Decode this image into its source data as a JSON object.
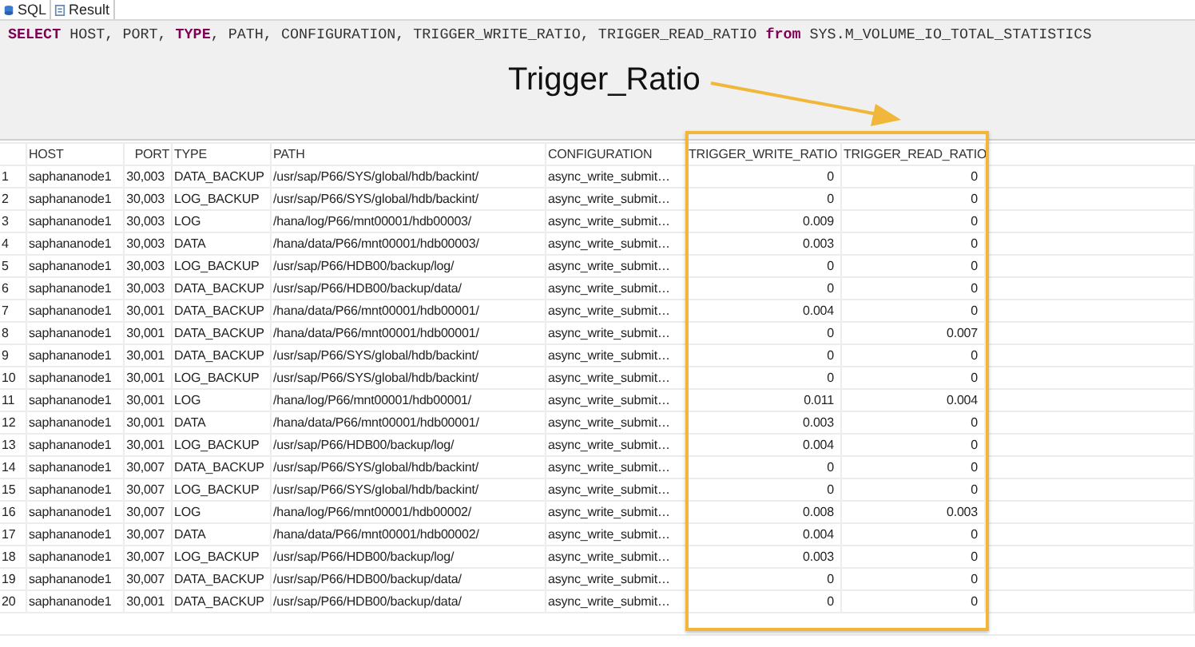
{
  "tabs": [
    {
      "label": "SQL"
    },
    {
      "label": "Result"
    }
  ],
  "sql": {
    "tokens": [
      {
        "text": "SELECT",
        "kind": "keyword"
      },
      {
        "text": " HOST, PORT, ",
        "kind": "plain"
      },
      {
        "text": "TYPE",
        "kind": "keyword"
      },
      {
        "text": ", PATH, CONFIGURATION, TRIGGER_WRITE_RATIO, TRIGGER_READ_RATIO ",
        "kind": "plain"
      },
      {
        "text": "from",
        "kind": "keyword"
      },
      {
        "text": " SYS.M_VOLUME_IO_TOTAL_STATISTICS",
        "kind": "plain"
      }
    ]
  },
  "annotation": {
    "label": "Trigger_Ratio"
  },
  "table": {
    "columns": [
      "",
      "HOST",
      "PORT",
      "TYPE",
      "PATH",
      "CONFIGURATION",
      "TRIGGER_WRITE_RATIO",
      "TRIGGER_READ_RATIO"
    ],
    "rows": [
      [
        "1",
        "saphananode1",
        "30,003",
        "DATA_BACKUP",
        "/usr/sap/P66/SYS/global/hdb/backint/",
        "async_write_submit…",
        "0",
        "0"
      ],
      [
        "2",
        "saphananode1",
        "30,003",
        "LOG_BACKUP",
        "/usr/sap/P66/SYS/global/hdb/backint/",
        "async_write_submit…",
        "0",
        "0"
      ],
      [
        "3",
        "saphananode1",
        "30,003",
        "LOG",
        "/hana/log/P66/mnt00001/hdb00003/",
        "async_write_submit…",
        "0.009",
        "0"
      ],
      [
        "4",
        "saphananode1",
        "30,003",
        "DATA",
        "/hana/data/P66/mnt00001/hdb00003/",
        "async_write_submit…",
        "0.003",
        "0"
      ],
      [
        "5",
        "saphananode1",
        "30,003",
        "LOG_BACKUP",
        "/usr/sap/P66/HDB00/backup/log/",
        "async_write_submit…",
        "0",
        "0"
      ],
      [
        "6",
        "saphananode1",
        "30,003",
        "DATA_BACKUP",
        "/usr/sap/P66/HDB00/backup/data/",
        "async_write_submit…",
        "0",
        "0"
      ],
      [
        "7",
        "saphananode1",
        "30,001",
        "DATA_BACKUP",
        "/hana/data/P66/mnt00001/hdb00001/",
        "async_write_submit…",
        "0.004",
        "0"
      ],
      [
        "8",
        "saphananode1",
        "30,001",
        "DATA_BACKUP",
        "/hana/data/P66/mnt00001/hdb00001/",
        "async_write_submit…",
        "0",
        "0.007"
      ],
      [
        "9",
        "saphananode1",
        "30,001",
        "DATA_BACKUP",
        "/usr/sap/P66/SYS/global/hdb/backint/",
        "async_write_submit…",
        "0",
        "0"
      ],
      [
        "10",
        "saphananode1",
        "30,001",
        "LOG_BACKUP",
        "/usr/sap/P66/SYS/global/hdb/backint/",
        "async_write_submit…",
        "0",
        "0"
      ],
      [
        "11",
        "saphananode1",
        "30,001",
        "LOG",
        "/hana/log/P66/mnt00001/hdb00001/",
        "async_write_submit…",
        "0.011",
        "0.004"
      ],
      [
        "12",
        "saphananode1",
        "30,001",
        "DATA",
        "/hana/data/P66/mnt00001/hdb00001/",
        "async_write_submit…",
        "0.003",
        "0"
      ],
      [
        "13",
        "saphananode1",
        "30,001",
        "LOG_BACKUP",
        "/usr/sap/P66/HDB00/backup/log/",
        "async_write_submit…",
        "0.004",
        "0"
      ],
      [
        "14",
        "saphananode1",
        "30,007",
        "DATA_BACKUP",
        "/usr/sap/P66/SYS/global/hdb/backint/",
        "async_write_submit…",
        "0",
        "0"
      ],
      [
        "15",
        "saphananode1",
        "30,007",
        "LOG_BACKUP",
        "/usr/sap/P66/SYS/global/hdb/backint/",
        "async_write_submit…",
        "0",
        "0"
      ],
      [
        "16",
        "saphananode1",
        "30,007",
        "LOG",
        "/hana/log/P66/mnt00001/hdb00002/",
        "async_write_submit…",
        "0.008",
        "0.003"
      ],
      [
        "17",
        "saphananode1",
        "30,007",
        "DATA",
        "/hana/data/P66/mnt00001/hdb00002/",
        "async_write_submit…",
        "0.004",
        "0"
      ],
      [
        "18",
        "saphananode1",
        "30,007",
        "LOG_BACKUP",
        "/usr/sap/P66/HDB00/backup/log/",
        "async_write_submit…",
        "0.003",
        "0"
      ],
      [
        "19",
        "saphananode1",
        "30,007",
        "DATA_BACKUP",
        "/usr/sap/P66/HDB00/backup/data/",
        "async_write_submit…",
        "0",
        "0"
      ],
      [
        "20",
        "saphananode1",
        "30,001",
        "DATA_BACKUP",
        "/usr/sap/P66/HDB00/backup/data/",
        "async_write_submit…",
        "0",
        "0"
      ]
    ]
  }
}
